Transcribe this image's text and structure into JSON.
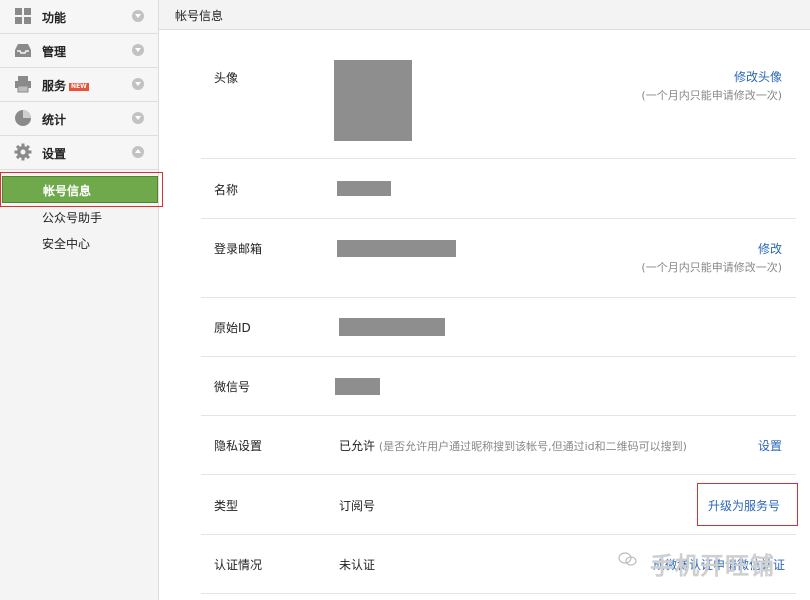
{
  "sidebar": {
    "groups": [
      {
        "label": "功能",
        "icon": "grid-icon"
      },
      {
        "label": "管理",
        "icon": "inbox-icon"
      },
      {
        "label": "服务",
        "icon": "printer-icon",
        "badge": "NEW"
      },
      {
        "label": "统计",
        "icon": "pie-chart-icon"
      },
      {
        "label": "设置",
        "icon": "gear-icon"
      }
    ],
    "settings_items": [
      {
        "label": "帐号信息",
        "active": true
      },
      {
        "label": "公众号助手"
      },
      {
        "label": "安全中心"
      }
    ]
  },
  "content": {
    "title": "帐号信息",
    "rows": {
      "avatar": {
        "label": "头像",
        "action": "修改头像",
        "note": "(一个月内只能申请修改一次)"
      },
      "name": {
        "label": "名称"
      },
      "email": {
        "label": "登录邮箱",
        "action": "修改",
        "note": "(一个月内只能申请修改一次)"
      },
      "original_id": {
        "label": "原始ID"
      },
      "wechat_id": {
        "label": "微信号"
      },
      "privacy": {
        "label": "隐私设置",
        "value": "已允许",
        "hint": "(是否允许用户通过昵称搜到该帐号,但通过id和二维码可以搜到)",
        "action": "设置"
      },
      "type": {
        "label": "类型",
        "value": "订阅号",
        "action": "升级为服务号"
      },
      "verification": {
        "label": "认证情况",
        "value": "未认证",
        "action_partial_1": "成微博认证",
        "action_partial_2": "申请微信认证"
      }
    }
  },
  "watermark": "手机开旺铺",
  "colors": {
    "active_nav": "#70a94c",
    "link": "#2c67b6",
    "highlight": "#d9322e",
    "mask": "#8e8e8e"
  }
}
